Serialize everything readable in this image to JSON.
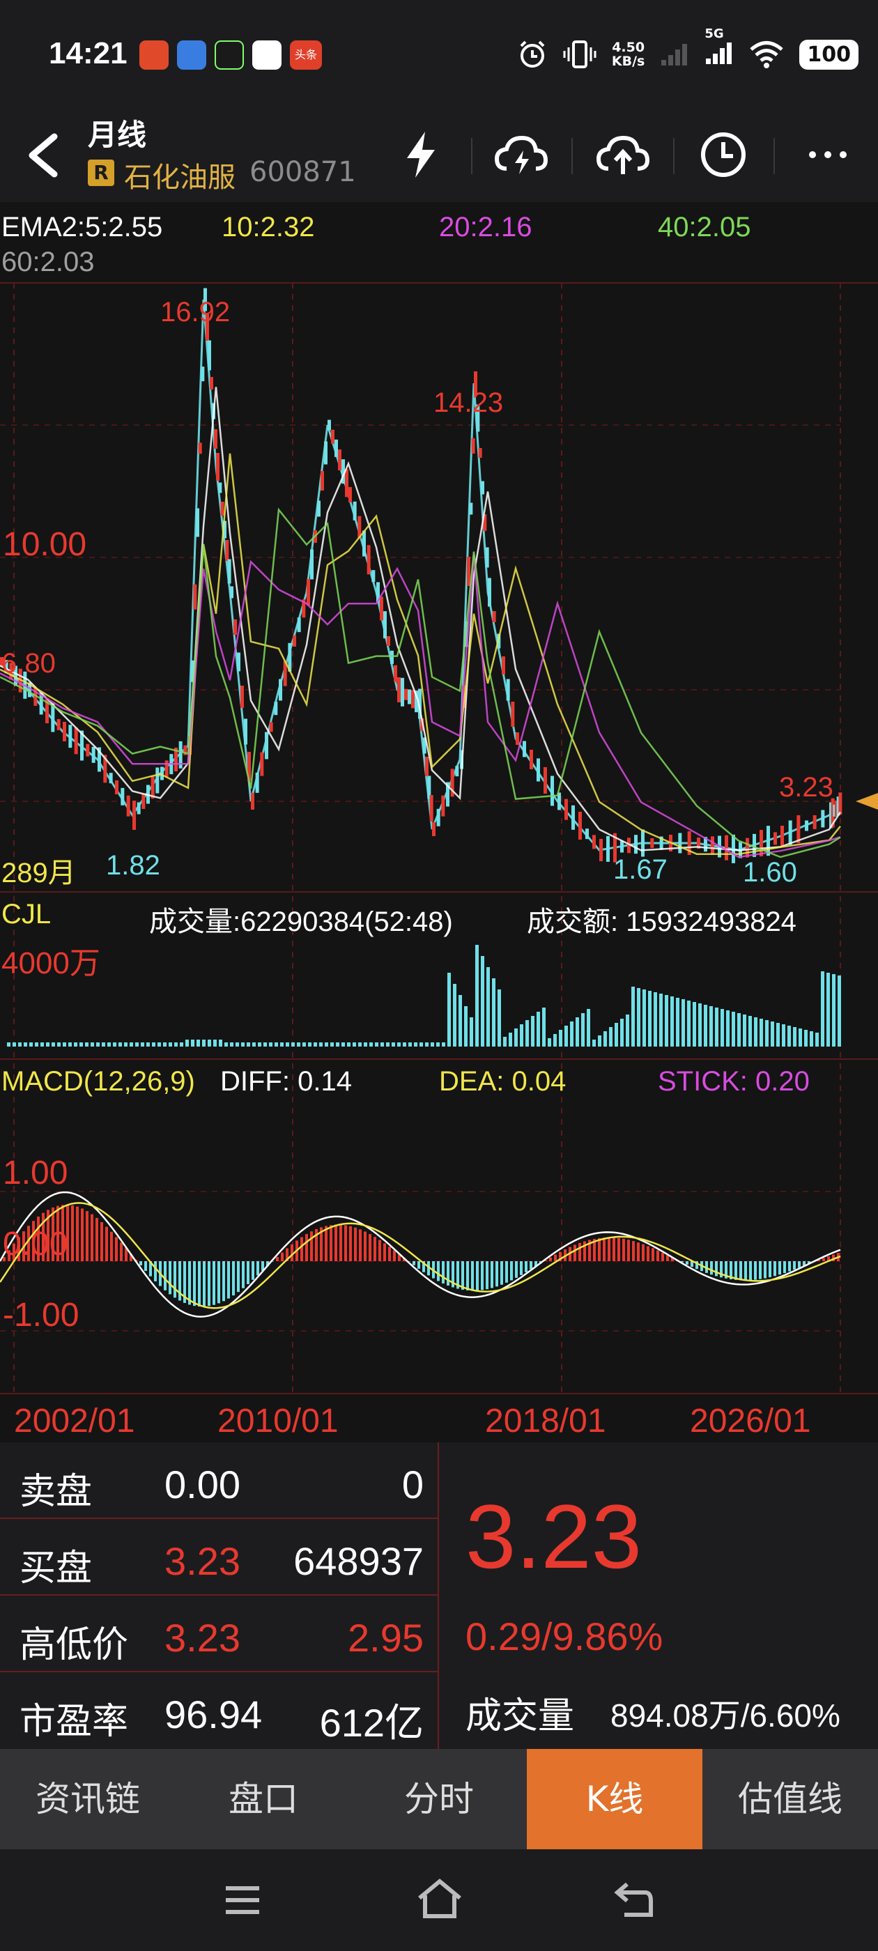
{
  "status": {
    "time": "14:21",
    "speed_top": "4.50",
    "speed_bottom": "KB/s",
    "signal": "5G",
    "battery": "100",
    "app_badge": "头条"
  },
  "header": {
    "period": "月线",
    "badge": "R",
    "stock_name": "石化油服",
    "stock_code": "600871"
  },
  "ema": {
    "label": "EMA2:5:2.55",
    "e10": "10:2.32",
    "e20": "20:2.16",
    "e40": "40:2.05",
    "e60": "60:2.03"
  },
  "price_chart": {
    "high_label": "16.92",
    "peak2_label": "14.23",
    "tick_10": "10.00",
    "tick_680": "6.80",
    "current_label": "3.23",
    "months": "289月",
    "low1": "1.82",
    "low2": "1.67",
    "low3": "1.60"
  },
  "volume": {
    "label": "CJL",
    "vol_text": "成交量:62290384(52:48)",
    "amount_text": "成交额: 15932493824",
    "scale": "4000万"
  },
  "macd": {
    "label": "MACD(12,26,9)",
    "diff": "DIFF: 0.14",
    "dea": "DEA: 0.04",
    "stick": "STICK: 0.20",
    "tick_pos": "1.00",
    "tick_zero": "0.00",
    "tick_neg": "-1.00"
  },
  "x_axis": [
    "2002/01",
    "2010/01",
    "2018/01",
    "2026/01"
  ],
  "quote": {
    "sell_label": "卖盘",
    "sell_price": "0.00",
    "sell_vol": "0",
    "buy_label": "买盘",
    "buy_price": "3.23",
    "buy_vol": "648937",
    "hl_label": "高低价",
    "high": "3.23",
    "low": "2.95",
    "pe_label": "市盈率",
    "pe": "96.94",
    "mcap": "612亿",
    "price": "3.23",
    "change": "0.29/9.86%",
    "vol_label": "成交量",
    "vol_value": "894.08万/6.60%"
  },
  "tabs": [
    "资讯链",
    "盘口",
    "分时",
    "K线",
    "估值线"
  ],
  "colors": {
    "up": "#e8392f",
    "down": "#6fe0e8",
    "ema5": "#ffffff",
    "ema10": "#f0e64a",
    "ema20": "#d94ce0",
    "ema40": "#7ed957",
    "active_tab": "#e2722c"
  }
}
